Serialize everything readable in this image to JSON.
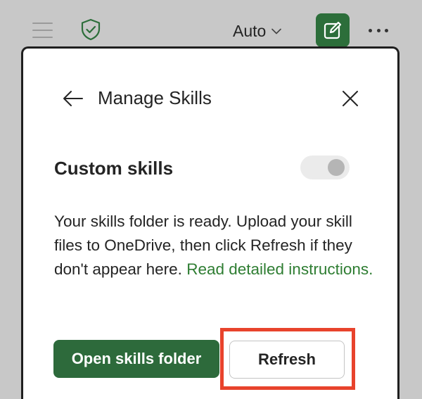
{
  "toolbar": {
    "mode_label": "Auto",
    "icons": [
      "hamburger-menu-icon",
      "shield-check-icon",
      "chevron-down-icon",
      "compose-icon",
      "more-icon"
    ],
    "compose_color": "#2c6e3a"
  },
  "dialog": {
    "title": "Manage Skills",
    "section_title": "Custom skills",
    "toggle_on": false,
    "description": "Your skills folder is ready. Upload your skill files to OneDrive, then click Refresh if they don't appear here.",
    "link_text": "Read detailed instructions.",
    "open_button_label": "Open skills folder",
    "refresh_button_label": "Refresh",
    "colors": {
      "primary": "#2d6a3b",
      "link": "#2e7d32",
      "highlight": "#e8432c"
    }
  }
}
